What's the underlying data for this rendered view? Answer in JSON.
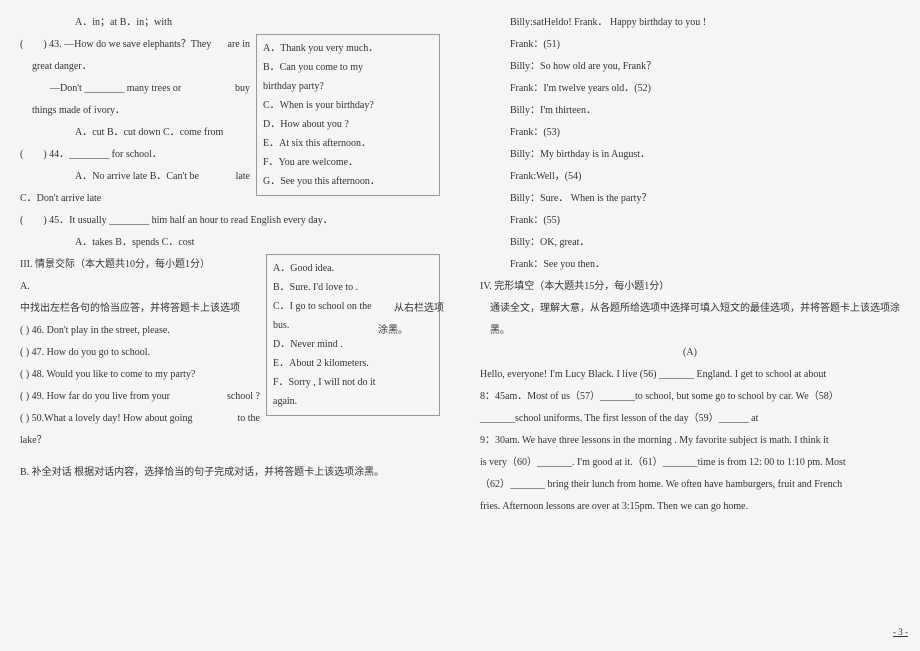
{
  "left": {
    "line_opts_top": "A．in；at  B．in；with",
    "box1": {
      "a": "A．Thank you very much．",
      "b": "B．Can you come to my",
      "b2": "birthday party?",
      "c": "C．When is your birthday?",
      "d": "D．How about you ?",
      "e": "E．At six this afternoon．",
      "f": "F．You are welcome．",
      "g": "G．See you this afternoon．"
    },
    "q43a": "(　　) 43. —How do we save elephants？They",
    "q43a_trail": "are in",
    "q43b": "great danger．",
    "q43c": "—Don't ________ many trees or",
    "q43c_trail": "buy",
    "q43d": "things made of ivory．",
    "q43opts": "A．cut  B．cut down  C．come from",
    "q44": "(　　) 44．________ for school．",
    "q44opts": "A．No arrive late    B．Can't be",
    "q44opts_trail": "late",
    "q44opts2": "C．Don't arrive late",
    "q45": "(　　) 45．It usually ________ him half an hour to read English every day．",
    "q45opts": "A．takes   B．spends    C．cost",
    "box2": {
      "a": "A．Good idea.",
      "b": "B．Sure. I'd love to .",
      "c": "C．I go to school on the",
      "c2": "bus.",
      "d": "D．Never mind .",
      "e": "E．About 2 kilometers.",
      "f": "F．Sorry , I will not do it",
      "f2": "again."
    },
    "sec3_title": "III. 情景交际（本大题共10分，每小题1分）",
    "sec3_a": "A.",
    "sec3_a_text": "中找出左栏各句的恰当应答，并将答题卡上该选项",
    "sec3_a_trail": "从右栏选项",
    "sec3_a_black": "涂黑。",
    "q46": "(  ) 46. Don't play in the street, please.",
    "q47": "(  ) 47. How do you go to school.",
    "q48": "(  ) 48. Would you like to come to my party?",
    "q49": "(  ) 49. How far do you live from your",
    "q49_trail": "school ?",
    "q50": "(  ) 50.What a lovely day! How about going",
    "q50_trail": "to the",
    "q50b": "lake？",
    "sec3_b_head": "B. 补全对话  根据对话内容，选择恰当的句子完成对话，并将答题卡上该选项涂黑。"
  },
  "right": {
    "overlap": "Billy:satHeldo! Frank．  Happy birthday to you !",
    "f51": "Frank：(51)",
    "b_q": "Billy：So how old are you, Frank？",
    "f_a1": "Frank：I'm twelve years old．(52)",
    "b_a1": "Billy：I'm thirteen．",
    "f53": "Frank：(53)",
    "b_aug": "Billy：My birthday is in August．",
    "f_well": "Frank:Well，(54)",
    "b_sure": "Billy：Sure． When is the party？",
    "f55": "Frank：(55)",
    "b_ok": "Billy：OK, great．",
    "f_see": "Frank：See you then．",
    "sec4_title": "IV. 完形填空（本大题共15分，每小题1分）",
    "sec4_intro": "通读全文，理解大意，从各题所给选项中选择可填入短文的最佳选项，并将答题卡上该选项涂黑。",
    "passage_label": "(A)",
    "p1": "Hello, everyone! I'm Lucy Black. I live (56) _______ England. I get to school at about",
    "p2": "8：45am．Most of us（57）_______to school, but some go to school by car. We（58）",
    "p3": "_______school uniforms. The first lesson of the day（59）______ at",
    "p4": "9：30am. We have three lessons in the morning . My favorite subject is math. I think it",
    "p5": "is very（60）_______. I'm good at it.（61）_______time is from 12: 00 to 1:10 pm. Most",
    "p6": "（62）_______ bring their lunch from home. We often have hamburgers,  fruit and French",
    "p7": "fries. Afternoon lessons are over at 3:15pm. Then we can go home.",
    "page_num": "- 3 -"
  }
}
